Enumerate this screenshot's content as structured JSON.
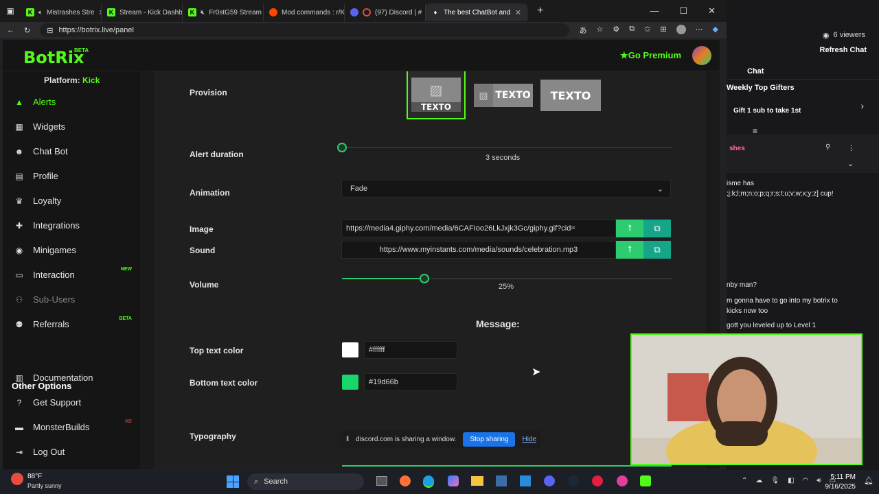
{
  "browser": {
    "tabs": [
      {
        "label": "Mistrashes Stre",
        "icon": "kick-icon",
        "color": "#53fc18"
      },
      {
        "label": "Stream - Kick Dashbo",
        "icon": "kick-icon",
        "color": "#53fc18"
      },
      {
        "label": "Fr0stG59 Stream",
        "icon": "kick-icon",
        "color": "#53fc18"
      },
      {
        "label": "Mod commands : r/K",
        "icon": "reddit-icon",
        "color": "#ff4500"
      },
      {
        "label": "(97) Discord | #",
        "icon": "discord-icon",
        "color": "#5865f2"
      },
      {
        "label": "The best ChatBot and",
        "icon": "botrix-icon",
        "color": "#ffffff"
      }
    ],
    "url": "https://botrix.live/panel"
  },
  "app": {
    "logo": "BotRix",
    "logo_badge": "BETA",
    "go_premium": "Go Premium",
    "platform_label": "Platform:",
    "platform_value": "Kick"
  },
  "sidebar": {
    "items": [
      {
        "label": "Alerts",
        "icon": "warning-icon",
        "active": true
      },
      {
        "label": "Widgets",
        "icon": "grid-icon"
      },
      {
        "label": "Chat Bot",
        "icon": "robot-icon"
      },
      {
        "label": "Profile",
        "icon": "id-card-icon"
      },
      {
        "label": "Loyalty",
        "icon": "trophy-icon"
      },
      {
        "label": "Integrations",
        "icon": "puzzle-icon"
      },
      {
        "label": "Minigames",
        "icon": "gamepad-icon"
      },
      {
        "label": "Interaction",
        "icon": "monitor-icon",
        "tag": "NEW"
      },
      {
        "label": "Sub-Users",
        "icon": "user-group-icon",
        "dim": true
      },
      {
        "label": "Referrals",
        "icon": "users-icon",
        "tag": "BETA"
      }
    ],
    "other_title": "Other Options",
    "other_items": [
      {
        "label": "Documentation",
        "icon": "book-icon"
      },
      {
        "label": "Get Support",
        "icon": "question-icon"
      },
      {
        "label": "MonsterBuilds",
        "icon": "laptop-icon",
        "tag": "AD"
      },
      {
        "label": "Log Out",
        "icon": "logout-icon"
      }
    ]
  },
  "form": {
    "provision_label": "Provision",
    "provision_options": [
      "TEXTO",
      "TEXTO",
      "TEXTO"
    ],
    "alert_duration_label": "Alert duration",
    "alert_duration_value": "3 seconds",
    "alert_duration_fraction": 0.0,
    "animation_label": "Animation",
    "animation_value": "Fade",
    "image_label": "Image",
    "image_value": "https://media4.giphy.com/media/6CAFIoo26LkJxjk3Gc/giphy.gif?cid=",
    "sound_label": "Sound",
    "sound_value": "https://www.myinstants.com/media/sounds/celebration.mp3",
    "volume_label": "Volume",
    "volume_value": "25%",
    "volume_fraction": 0.25,
    "message_title": "Message:",
    "top_color_label": "Top text color",
    "top_color_value": "#ffffff",
    "bottom_color_label": "Bottom text color",
    "bottom_color_value": "#19d66b",
    "typography_label": "Typography"
  },
  "share_bar": {
    "text": "discord.com is sharing a window.",
    "stop": "Stop sharing",
    "hide": "Hide"
  },
  "chat": {
    "viewers": "6 viewers",
    "refresh": "Refresh Chat",
    "title": "Chat",
    "gifters_title": "Weekly Top Gifters",
    "gift_text": "Gift 1 sub to take 1st",
    "pinned_user": "shes",
    "messages": [
      "isme has",
      ";j;k;l;m;n;o;p;q;r;s;t;u;v;w;x;y;z] cup!",
      "nby man?",
      "m gonna have to go into my botrix to",
      "kicks now too",
      "gott you leveled up to Level 1"
    ]
  },
  "taskbar": {
    "weather_temp": "88°F",
    "weather_desc": "Partly sunny",
    "search": "Search",
    "time": "5:11 PM",
    "date": "9/16/2025"
  },
  "colors": {
    "accent": "#53fc18",
    "green_btn": "#2ecc71",
    "teal_btn": "#17a589"
  }
}
